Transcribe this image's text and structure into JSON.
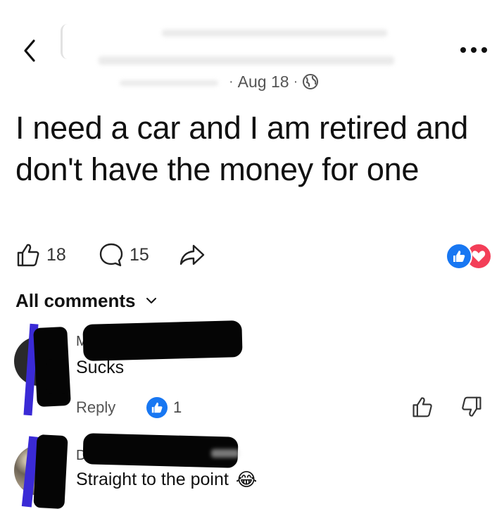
{
  "post": {
    "date": "Aug 18",
    "separator": "·",
    "text": "I need a car and I am retired and don't have the money for one",
    "like_count": "18",
    "comment_count": "15"
  },
  "comments_header": {
    "label": "All comments"
  },
  "comments": [
    {
      "author_initial": "M",
      "text": "Sucks",
      "reply_label": "Reply",
      "like_count": "1"
    },
    {
      "author_initial": "D",
      "text": "Straight to the point",
      "emoji": "😂"
    }
  ],
  "colors": {
    "like_blue": "#1877f2",
    "love_red": "#f33e58",
    "text_primary": "#111111",
    "text_secondary": "#555555"
  },
  "icons": {
    "back": "chevron-left-icon",
    "more": "more-horizontal-icon",
    "globe": "globe-icon",
    "like": "thumbs-up-icon",
    "comment": "comment-bubble-icon",
    "share": "share-arrow-icon",
    "dislike": "thumbs-down-icon",
    "expand": "chevron-down-icon"
  }
}
